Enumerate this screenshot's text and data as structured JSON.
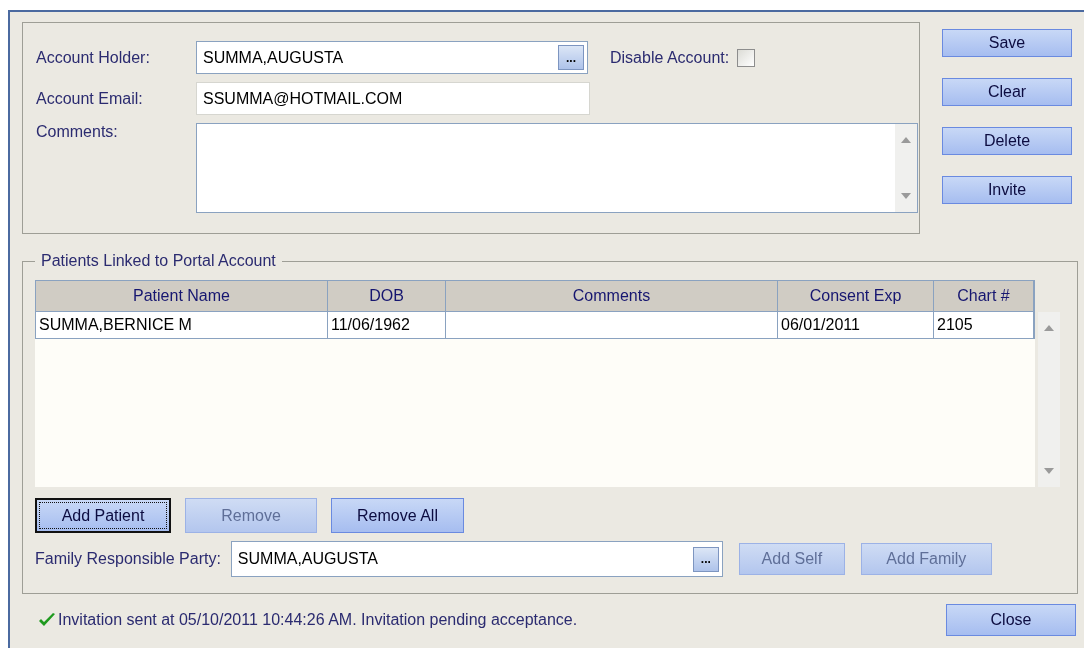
{
  "account": {
    "holder_label": "Account Holder:",
    "holder_value": "SUMMA,AUGUSTA",
    "browse_label": "...",
    "disable_label": "Disable Account:",
    "disable_checked": false,
    "email_label": "Account Email:",
    "email_value": "SSUMMA@HOTMAIL.COM",
    "comments_label": "Comments:"
  },
  "side_buttons": [
    {
      "label": "Save",
      "disabled": false
    },
    {
      "label": "Clear",
      "disabled": false
    },
    {
      "label": "Delete",
      "disabled": false
    },
    {
      "label": "Invite",
      "disabled": false
    }
  ],
  "patients": {
    "title": "Patients Linked to Portal Account",
    "columns": [
      "Patient Name",
      "DOB",
      "Comments",
      "Consent Exp",
      "Chart #"
    ],
    "rows": [
      {
        "cells": [
          "SUMMA,BERNICE M",
          "11/06/1962",
          "",
          "06/01/2011",
          "2105"
        ]
      }
    ],
    "buttons": [
      {
        "label": "Add Patient",
        "disabled": false,
        "focused": true
      },
      {
        "label": "Remove",
        "disabled": true,
        "focused": false
      },
      {
        "label": "Remove All",
        "disabled": false,
        "focused": false
      }
    ],
    "family_label": "Family Responsible Party:",
    "family_value": "SUMMA,AUGUSTA",
    "family_browse": "...",
    "family_buttons": [
      {
        "label": "Add Self",
        "disabled": true
      },
      {
        "label": "Add Family",
        "disabled": true
      }
    ]
  },
  "status": {
    "message": "Invitation sent at 05/10/2011 10:44:26 AM. Invitation pending acceptance.",
    "success": true
  },
  "close_button": {
    "label": "Close",
    "disabled": false
  }
}
